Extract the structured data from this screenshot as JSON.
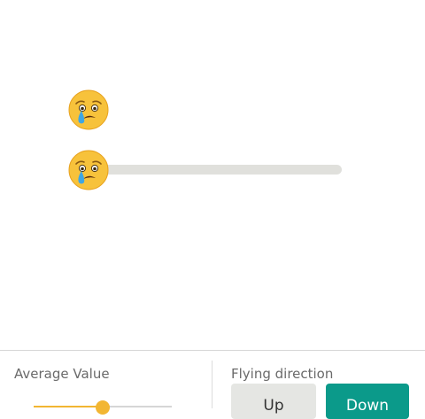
{
  "emoji": {
    "current": "crying-face-icon"
  },
  "slider": {
    "value": 0.0
  },
  "controls": {
    "average_value": {
      "label": "Average Value",
      "value": 0.5
    },
    "flying_direction": {
      "label": "Flying direction",
      "options": [
        "Up",
        "Down"
      ],
      "selected": "Down"
    }
  },
  "colors": {
    "track": "#e0e0dc",
    "accent": "#f2b632",
    "selected_button": "#0b9a8a",
    "unselected_button": "#e5e6e3"
  }
}
